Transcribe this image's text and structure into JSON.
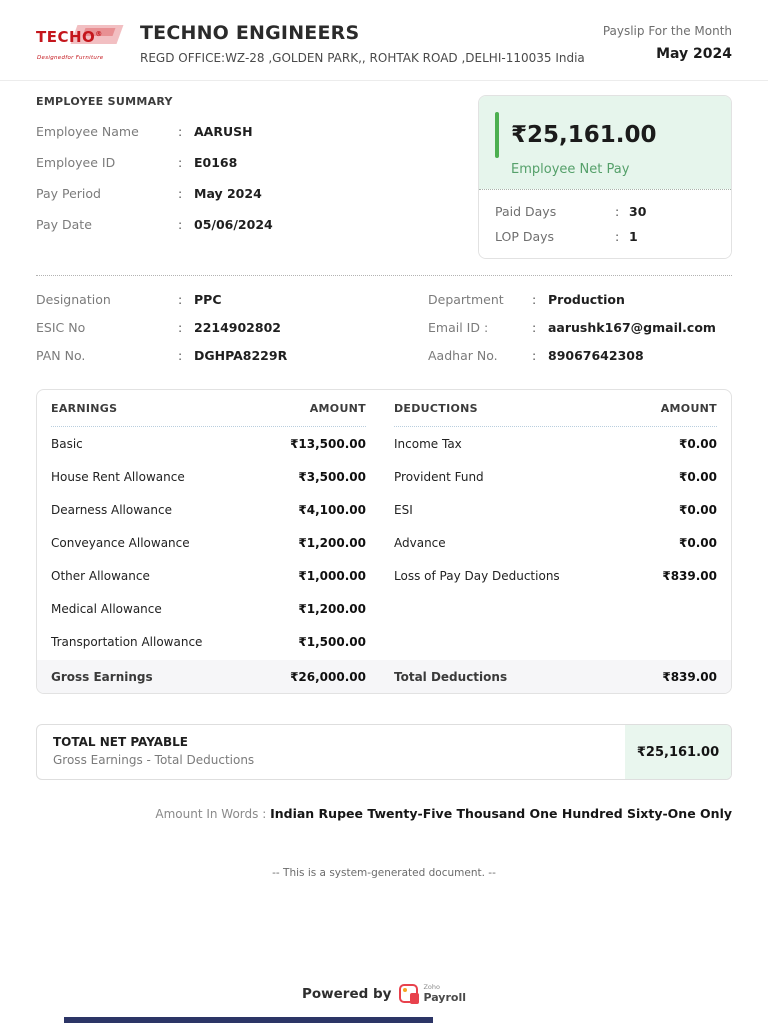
{
  "ui": {
    "colon": ":"
  },
  "header": {
    "logo_brand": "TECHO",
    "logo_reg": "®",
    "logo_tagline": "Designedfor Furniture",
    "company_name": "TECHNO ENGINEERS",
    "company_address": "REGD OFFICE:WZ-28 ,GOLDEN PARK,, ROHTAK ROAD ,DELHI-110035 India",
    "payslip_label": "Payslip For the Month",
    "payslip_month": "May 2024"
  },
  "employee_summary": {
    "title": "EMPLOYEE SUMMARY",
    "rows": [
      {
        "label": "Employee Name",
        "value": "AARUSH"
      },
      {
        "label": "Employee ID",
        "value": "E0168"
      },
      {
        "label": "Pay Period",
        "value": "May 2024"
      },
      {
        "label": "Pay Date",
        "value": "05/06/2024"
      }
    ]
  },
  "net_pay_card": {
    "amount": "₹25,161.00",
    "caption": "Employee Net Pay",
    "rows": [
      {
        "label": "Paid Days",
        "value": "30"
      },
      {
        "label": "LOP Days",
        "value": "1"
      }
    ]
  },
  "details": {
    "left": [
      {
        "label": "Designation",
        "value": "PPC"
      },
      {
        "label": "ESIC No",
        "value": "2214902802"
      },
      {
        "label": "PAN No.",
        "value": "DGHPA8229R"
      }
    ],
    "right": [
      {
        "label": "Department",
        "value": "Production"
      },
      {
        "label": "Email ID :",
        "value": "aarushk167@gmail.com"
      },
      {
        "label": "Aadhar No.",
        "value": "89067642308"
      }
    ]
  },
  "table": {
    "earnings_header": "EARNINGS",
    "amount_header": "AMOUNT",
    "deductions_header": "DEDUCTIONS",
    "earnings": [
      {
        "name": "Basic",
        "amount": "₹13,500.00"
      },
      {
        "name": "House Rent Allowance",
        "amount": "₹3,500.00"
      },
      {
        "name": "Dearness Allowance",
        "amount": "₹4,100.00"
      },
      {
        "name": "Conveyance Allowance",
        "amount": "₹1,200.00"
      },
      {
        "name": "Other Allowance",
        "amount": "₹1,000.00"
      },
      {
        "name": "Medical Allowance",
        "amount": "₹1,200.00"
      },
      {
        "name": "Transportation Allowance",
        "amount": "₹1,500.00"
      }
    ],
    "deductions": [
      {
        "name": "Income Tax",
        "amount": "₹0.00"
      },
      {
        "name": "Provident Fund",
        "amount": "₹0.00"
      },
      {
        "name": "ESI",
        "amount": "₹0.00"
      },
      {
        "name": "Advance",
        "amount": "₹0.00"
      },
      {
        "name": "Loss of Pay Day Deductions",
        "amount": "₹839.00"
      }
    ],
    "gross_label": "Gross Earnings",
    "gross_amount": "₹26,000.00",
    "total_deductions_label": "Total Deductions",
    "total_deductions_amount": "₹839.00"
  },
  "net_payable": {
    "title": "TOTAL NET PAYABLE",
    "subtitle": "Gross Earnings - Total Deductions",
    "amount": "₹25,161.00"
  },
  "amount_in_words": {
    "label": "Amount In Words :",
    "value": "Indian Rupee Twenty-Five Thousand One Hundred Sixty-One Only"
  },
  "footer": {
    "system_note": "-- This is a system-generated document. --",
    "powered_by": "Powered by",
    "zoho_brand_top": "Zoho",
    "zoho_brand_bottom": "Payroll"
  },
  "colors": {
    "accent_green": "#4caf50",
    "light_green_bg": "#e6f5ec",
    "brand_red": "#c4161c",
    "zoho_red": "#e8424d",
    "bottom_bar_navy": "#2c3566"
  }
}
